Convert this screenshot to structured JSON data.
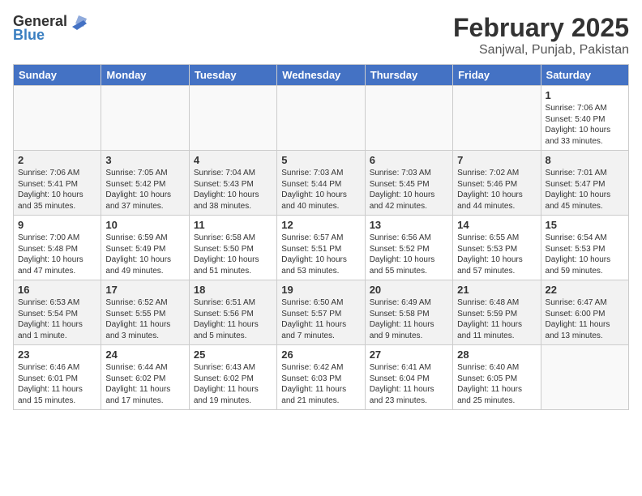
{
  "header": {
    "logo_general": "General",
    "logo_blue": "Blue",
    "month_title": "February 2025",
    "location": "Sanjwal, Punjab, Pakistan"
  },
  "days_of_week": [
    "Sunday",
    "Monday",
    "Tuesday",
    "Wednesday",
    "Thursday",
    "Friday",
    "Saturday"
  ],
  "weeks": [
    [
      {
        "day": "",
        "info": ""
      },
      {
        "day": "",
        "info": ""
      },
      {
        "day": "",
        "info": ""
      },
      {
        "day": "",
        "info": ""
      },
      {
        "day": "",
        "info": ""
      },
      {
        "day": "",
        "info": ""
      },
      {
        "day": "1",
        "info": "Sunrise: 7:06 AM\nSunset: 5:40 PM\nDaylight: 10 hours\nand 33 minutes."
      }
    ],
    [
      {
        "day": "2",
        "info": "Sunrise: 7:06 AM\nSunset: 5:41 PM\nDaylight: 10 hours\nand 35 minutes."
      },
      {
        "day": "3",
        "info": "Sunrise: 7:05 AM\nSunset: 5:42 PM\nDaylight: 10 hours\nand 37 minutes."
      },
      {
        "day": "4",
        "info": "Sunrise: 7:04 AM\nSunset: 5:43 PM\nDaylight: 10 hours\nand 38 minutes."
      },
      {
        "day": "5",
        "info": "Sunrise: 7:03 AM\nSunset: 5:44 PM\nDaylight: 10 hours\nand 40 minutes."
      },
      {
        "day": "6",
        "info": "Sunrise: 7:03 AM\nSunset: 5:45 PM\nDaylight: 10 hours\nand 42 minutes."
      },
      {
        "day": "7",
        "info": "Sunrise: 7:02 AM\nSunset: 5:46 PM\nDaylight: 10 hours\nand 44 minutes."
      },
      {
        "day": "8",
        "info": "Sunrise: 7:01 AM\nSunset: 5:47 PM\nDaylight: 10 hours\nand 45 minutes."
      }
    ],
    [
      {
        "day": "9",
        "info": "Sunrise: 7:00 AM\nSunset: 5:48 PM\nDaylight: 10 hours\nand 47 minutes."
      },
      {
        "day": "10",
        "info": "Sunrise: 6:59 AM\nSunset: 5:49 PM\nDaylight: 10 hours\nand 49 minutes."
      },
      {
        "day": "11",
        "info": "Sunrise: 6:58 AM\nSunset: 5:50 PM\nDaylight: 10 hours\nand 51 minutes."
      },
      {
        "day": "12",
        "info": "Sunrise: 6:57 AM\nSunset: 5:51 PM\nDaylight: 10 hours\nand 53 minutes."
      },
      {
        "day": "13",
        "info": "Sunrise: 6:56 AM\nSunset: 5:52 PM\nDaylight: 10 hours\nand 55 minutes."
      },
      {
        "day": "14",
        "info": "Sunrise: 6:55 AM\nSunset: 5:53 PM\nDaylight: 10 hours\nand 57 minutes."
      },
      {
        "day": "15",
        "info": "Sunrise: 6:54 AM\nSunset: 5:53 PM\nDaylight: 10 hours\nand 59 minutes."
      }
    ],
    [
      {
        "day": "16",
        "info": "Sunrise: 6:53 AM\nSunset: 5:54 PM\nDaylight: 11 hours\nand 1 minute."
      },
      {
        "day": "17",
        "info": "Sunrise: 6:52 AM\nSunset: 5:55 PM\nDaylight: 11 hours\nand 3 minutes."
      },
      {
        "day": "18",
        "info": "Sunrise: 6:51 AM\nSunset: 5:56 PM\nDaylight: 11 hours\nand 5 minutes."
      },
      {
        "day": "19",
        "info": "Sunrise: 6:50 AM\nSunset: 5:57 PM\nDaylight: 11 hours\nand 7 minutes."
      },
      {
        "day": "20",
        "info": "Sunrise: 6:49 AM\nSunset: 5:58 PM\nDaylight: 11 hours\nand 9 minutes."
      },
      {
        "day": "21",
        "info": "Sunrise: 6:48 AM\nSunset: 5:59 PM\nDaylight: 11 hours\nand 11 minutes."
      },
      {
        "day": "22",
        "info": "Sunrise: 6:47 AM\nSunset: 6:00 PM\nDaylight: 11 hours\nand 13 minutes."
      }
    ],
    [
      {
        "day": "23",
        "info": "Sunrise: 6:46 AM\nSunset: 6:01 PM\nDaylight: 11 hours\nand 15 minutes."
      },
      {
        "day": "24",
        "info": "Sunrise: 6:44 AM\nSunset: 6:02 PM\nDaylight: 11 hours\nand 17 minutes."
      },
      {
        "day": "25",
        "info": "Sunrise: 6:43 AM\nSunset: 6:02 PM\nDaylight: 11 hours\nand 19 minutes."
      },
      {
        "day": "26",
        "info": "Sunrise: 6:42 AM\nSunset: 6:03 PM\nDaylight: 11 hours\nand 21 minutes."
      },
      {
        "day": "27",
        "info": "Sunrise: 6:41 AM\nSunset: 6:04 PM\nDaylight: 11 hours\nand 23 minutes."
      },
      {
        "day": "28",
        "info": "Sunrise: 6:40 AM\nSunset: 6:05 PM\nDaylight: 11 hours\nand 25 minutes."
      },
      {
        "day": "",
        "info": ""
      }
    ]
  ]
}
